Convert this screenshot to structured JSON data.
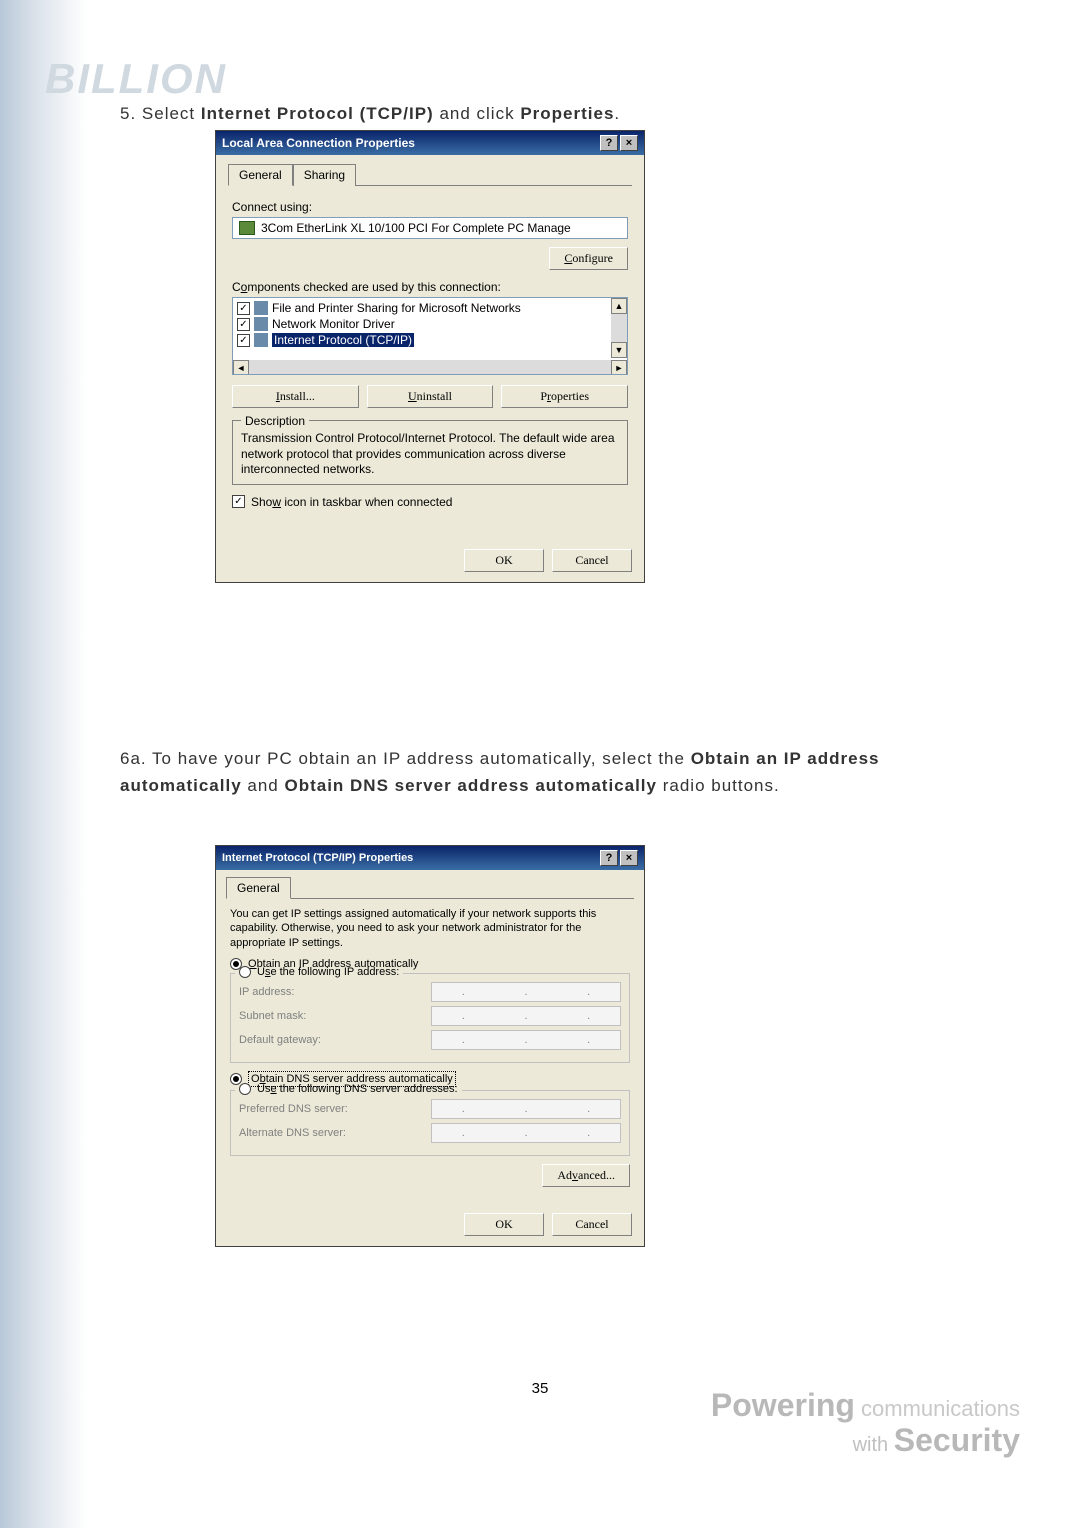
{
  "logo": "BILLION",
  "step5": {
    "prefix": "5. Select ",
    "bold": "Internet Protocol (TCP/IP)",
    "mid": " and click ",
    "bold2": "Properties",
    "suffix": "."
  },
  "dialog1": {
    "title": "Local Area Connection Properties",
    "tabs": {
      "general": "General",
      "sharing": "Sharing"
    },
    "connect_label": "Connect using:",
    "adapter": "3Com EtherLink XL 10/100 PCI For Complete PC Manage",
    "configure": "Configure",
    "components_label": "Components checked are used by this connection:",
    "items": [
      "File and Printer Sharing for Microsoft Networks",
      "Network Monitor Driver",
      "Internet Protocol (TCP/IP)"
    ],
    "install": "Install...",
    "uninstall": "Uninstall",
    "properties": "Properties",
    "description_label": "Description",
    "description_text": "Transmission Control Protocol/Internet Protocol. The default wide area network protocol that provides communication across diverse interconnected networks.",
    "show_icon": "Show icon in taskbar when connected",
    "ok": "OK",
    "cancel": "Cancel"
  },
  "step6a": {
    "part1": "6a. To have your PC obtain an IP address automatically, select the ",
    "bold1": "Obtain an IP address automatically",
    "part2": " and ",
    "bold2": "Obtain DNS server address automatically",
    "part3": " radio buttons."
  },
  "dialog2": {
    "title": "Internet Protocol (TCP/IP) Properties",
    "tab": "General",
    "info": "You can get IP settings assigned automatically if your network supports this capability. Otherwise, you need to ask your network administrator for the appropriate IP settings.",
    "obtain_ip": "Obtain an IP address automatically",
    "use_ip": "Use the following IP address:",
    "ip_address": "IP address:",
    "subnet": "Subnet mask:",
    "gateway": "Default gateway:",
    "obtain_dns": "Obtain DNS server address automatically",
    "use_dns": "Use the following DNS server addresses:",
    "pref_dns": "Preferred DNS server:",
    "alt_dns": "Alternate DNS server:",
    "advanced": "Advanced...",
    "ok": "OK",
    "cancel": "Cancel"
  },
  "page_number": "35",
  "footer": {
    "powering": "Powering",
    "comm": " communications",
    "with": "with ",
    "security": "Security"
  }
}
